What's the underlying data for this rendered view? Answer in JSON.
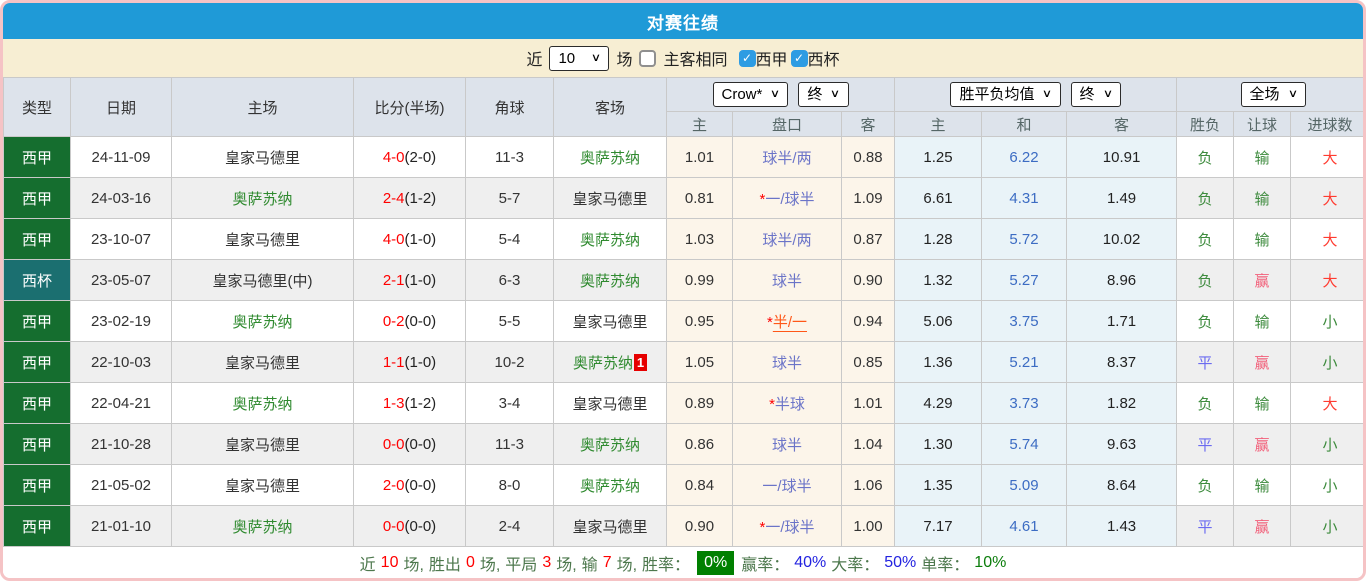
{
  "title": "对赛往绩",
  "filter": {
    "recent_label": "近",
    "games_count": "10",
    "games_label": "场",
    "same_venue_label": "主客相同",
    "leagues": [
      {
        "label": "西甲",
        "checked": true
      },
      {
        "label": "西杯",
        "checked": true
      }
    ]
  },
  "header": {
    "static_cols": [
      "类型",
      "日期",
      "主场",
      "比分(半场)",
      "角球",
      "客场"
    ],
    "odds_provider_select": "Crow*",
    "odds_stage_select": "终",
    "avg_select": "胜平负均值",
    "avg_stage_select": "终",
    "scope_select": "全场",
    "sub_cols": [
      "主",
      "盘口",
      "客",
      "主",
      "和",
      "客",
      "胜负",
      "让球",
      "进球数"
    ]
  },
  "rows": [
    {
      "type": "西甲",
      "type_class": "league",
      "date": "24-11-09",
      "home": "皇家马德里",
      "home_is_focus": false,
      "score": "4-0",
      "half": "(2-0)",
      "corner": "11-3",
      "away": "奥萨苏纳",
      "away_is_focus": true,
      "away_badge": "",
      "odds_home": "1.01",
      "handicap_star_mark": "",
      "handicap": "球半/两",
      "handicap_hot": false,
      "odds_away": "0.88",
      "avg_home": "1.25",
      "avg_draw": "6.22",
      "avg_away": "10.91",
      "result": "负",
      "result_class": "green",
      "handicap_result": "输",
      "hr_class": "green",
      "goals_result": "大",
      "goals_class": "red"
    },
    {
      "type": "西甲",
      "type_class": "league",
      "date": "24-03-16",
      "home": "奥萨苏纳",
      "home_is_focus": true,
      "score": "2-4",
      "half": "(1-2)",
      "corner": "5-7",
      "away": "皇家马德里",
      "away_is_focus": false,
      "away_badge": "",
      "odds_home": "0.81",
      "handicap_star_mark": "*",
      "handicap": "一/球半",
      "handicap_hot": false,
      "odds_away": "1.09",
      "avg_home": "6.61",
      "avg_draw": "4.31",
      "avg_away": "1.49",
      "result": "负",
      "result_class": "green",
      "handicap_result": "输",
      "hr_class": "green",
      "goals_result": "大",
      "goals_class": "red"
    },
    {
      "type": "西甲",
      "type_class": "league",
      "date": "23-10-07",
      "home": "皇家马德里",
      "home_is_focus": false,
      "score": "4-0",
      "half": "(1-0)",
      "corner": "5-4",
      "away": "奥萨苏纳",
      "away_is_focus": true,
      "away_badge": "",
      "odds_home": "1.03",
      "handicap_star_mark": "",
      "handicap": "球半/两",
      "handicap_hot": false,
      "odds_away": "0.87",
      "avg_home": "1.28",
      "avg_draw": "5.72",
      "avg_away": "10.02",
      "result": "负",
      "result_class": "green",
      "handicap_result": "输",
      "hr_class": "green",
      "goals_result": "大",
      "goals_class": "red"
    },
    {
      "type": "西杯",
      "type_class": "cup",
      "date": "23-05-07",
      "home": "皇家马德里(中)",
      "home_is_focus": false,
      "score": "2-1",
      "half": "(1-0)",
      "corner": "6-3",
      "away": "奥萨苏纳",
      "away_is_focus": true,
      "away_badge": "",
      "odds_home": "0.99",
      "handicap_star_mark": "",
      "handicap": "球半",
      "handicap_hot": false,
      "odds_away": "0.90",
      "avg_home": "1.32",
      "avg_draw": "5.27",
      "avg_away": "8.96",
      "result": "负",
      "result_class": "green",
      "handicap_result": "赢",
      "hr_class": "pink",
      "goals_result": "大",
      "goals_class": "red"
    },
    {
      "type": "西甲",
      "type_class": "league",
      "date": "23-02-19",
      "home": "奥萨苏纳",
      "home_is_focus": true,
      "score": "0-2",
      "half": "(0-0)",
      "corner": "5-5",
      "away": "皇家马德里",
      "away_is_focus": false,
      "away_badge": "",
      "odds_home": "0.95",
      "handicap_star_mark": "*",
      "handicap": "半/一",
      "handicap_hot": true,
      "odds_away": "0.94",
      "avg_home": "5.06",
      "avg_draw": "3.75",
      "avg_away": "1.71",
      "result": "负",
      "result_class": "green",
      "handicap_result": "输",
      "hr_class": "green",
      "goals_result": "小",
      "goals_class": "green"
    },
    {
      "type": "西甲",
      "type_class": "league",
      "date": "22-10-03",
      "home": "皇家马德里",
      "home_is_focus": false,
      "score": "1-1",
      "half": "(1-0)",
      "corner": "10-2",
      "away": "奥萨苏纳",
      "away_is_focus": true,
      "away_badge": "1",
      "odds_home": "1.05",
      "handicap_star_mark": "",
      "handicap": "球半",
      "handicap_hot": false,
      "odds_away": "0.85",
      "avg_home": "1.36",
      "avg_draw": "5.21",
      "avg_away": "8.37",
      "result": "平",
      "result_class": "blue",
      "handicap_result": "赢",
      "hr_class": "pink",
      "goals_result": "小",
      "goals_class": "green"
    },
    {
      "type": "西甲",
      "type_class": "league",
      "date": "22-04-21",
      "home": "奥萨苏纳",
      "home_is_focus": true,
      "score": "1-3",
      "half": "(1-2)",
      "corner": "3-4",
      "away": "皇家马德里",
      "away_is_focus": false,
      "away_badge": "",
      "odds_home": "0.89",
      "handicap_star_mark": "*",
      "handicap": "半球",
      "handicap_hot": false,
      "odds_away": "1.01",
      "avg_home": "4.29",
      "avg_draw": "3.73",
      "avg_away": "1.82",
      "result": "负",
      "result_class": "green",
      "handicap_result": "输",
      "hr_class": "green",
      "goals_result": "大",
      "goals_class": "red"
    },
    {
      "type": "西甲",
      "type_class": "league",
      "date": "21-10-28",
      "home": "皇家马德里",
      "home_is_focus": false,
      "score": "0-0",
      "half": "(0-0)",
      "corner": "11-3",
      "away": "奥萨苏纳",
      "away_is_focus": true,
      "away_badge": "",
      "odds_home": "0.86",
      "handicap_star_mark": "",
      "handicap": "球半",
      "handicap_hot": false,
      "odds_away": "1.04",
      "avg_home": "1.30",
      "avg_draw": "5.74",
      "avg_away": "9.63",
      "result": "平",
      "result_class": "blue",
      "handicap_result": "赢",
      "hr_class": "pink",
      "goals_result": "小",
      "goals_class": "green"
    },
    {
      "type": "西甲",
      "type_class": "league",
      "date": "21-05-02",
      "home": "皇家马德里",
      "home_is_focus": false,
      "score": "2-0",
      "half": "(0-0)",
      "corner": "8-0",
      "away": "奥萨苏纳",
      "away_is_focus": true,
      "away_badge": "",
      "odds_home": "0.84",
      "handicap_star_mark": "",
      "handicap": "一/球半",
      "handicap_hot": false,
      "odds_away": "1.06",
      "avg_home": "1.35",
      "avg_draw": "5.09",
      "avg_away": "8.64",
      "result": "负",
      "result_class": "green",
      "handicap_result": "输",
      "hr_class": "green",
      "goals_result": "小",
      "goals_class": "green"
    },
    {
      "type": "西甲",
      "type_class": "league",
      "date": "21-01-10",
      "home": "奥萨苏纳",
      "home_is_focus": true,
      "score": "0-0",
      "half": "(0-0)",
      "corner": "2-4",
      "away": "皇家马德里",
      "away_is_focus": false,
      "away_badge": "",
      "odds_home": "0.90",
      "handicap_star_mark": "*",
      "handicap": "一/球半",
      "handicap_hot": false,
      "odds_away": "1.00",
      "avg_home": "7.17",
      "avg_draw": "4.61",
      "avg_away": "1.43",
      "result": "平",
      "result_class": "blue",
      "handicap_result": "赢",
      "hr_class": "pink",
      "goals_result": "小",
      "goals_class": "green"
    }
  ],
  "summary": {
    "recent_label": "近",
    "recent_games": "10",
    "games_suffix": "场,",
    "win_label": "胜出",
    "wins": "0",
    "win_suffix": "场,",
    "draw_label": "平局",
    "draws": "3",
    "draw_suffix": "场,",
    "lose_label": "输",
    "losses": "7",
    "lose_suffix": "场,",
    "winrate_label": "胜率：",
    "win_rate": "0%",
    "handicap_rate_label": "赢率：",
    "handicap_rate": "40%",
    "big_rate_label": "大率：",
    "big_rate": "50%",
    "single_rate_label": "单率：",
    "single_rate": "10%"
  },
  "colors": {
    "accent_blue": "#1f9ad7",
    "filter_bg": "#f7eed3",
    "header_bg": "#dde3eb",
    "league_green": "#156e2f",
    "cup_teal": "#1b6f70",
    "focus_team_green": "#2f8a2f",
    "score_red": "#ff0000",
    "handicap_blue": "#6b74c8",
    "handicap_hot_orange": "#ff5718",
    "avg_draw_blue": "#3c6cc3",
    "crow_col_bg": "#fcf5ea",
    "avg_col_bg": "#e9f3f8",
    "result_green": "#3d8b3d",
    "result_blue": "#6b6bf0",
    "result_pink": "#f2607a",
    "result_red": "#ff3b30",
    "rate_badge_green": "#008000",
    "rate_blue": "#2323e0",
    "single_rate_green": "#0b7d0b",
    "stripe_gray": "#efefef",
    "border_pink": "#f5c3c5"
  }
}
